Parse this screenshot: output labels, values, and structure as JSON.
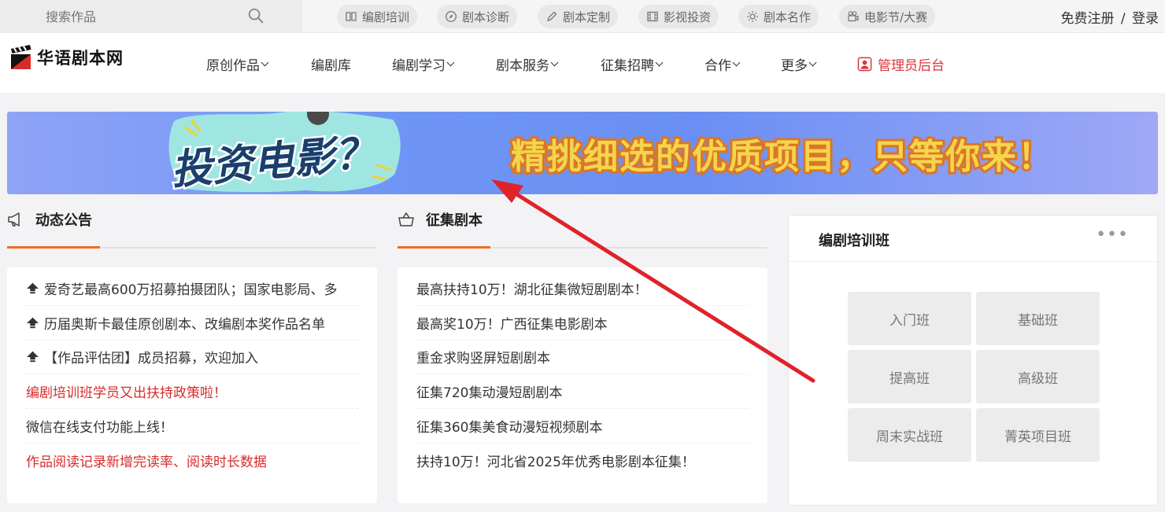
{
  "topbar": {
    "search_placeholder": "搜索作品",
    "pills": [
      {
        "label": "编剧培训",
        "icon": "book-icon"
      },
      {
        "label": "剧本诊断",
        "icon": "compass-icon"
      },
      {
        "label": "剧本定制",
        "icon": "pen-icon"
      },
      {
        "label": "影视投资",
        "icon": "film-icon"
      },
      {
        "label": "剧本名作",
        "icon": "sun-icon"
      },
      {
        "label": "电影节/大赛",
        "icon": "camera-icon"
      }
    ],
    "register": "免费注册",
    "separator": "/",
    "login": "登录"
  },
  "nav": {
    "logo_text": "华语剧本网",
    "items": [
      {
        "label": "原创作品",
        "dropdown": true
      },
      {
        "label": "编剧库",
        "dropdown": false
      },
      {
        "label": "编剧学习",
        "dropdown": true
      },
      {
        "label": "剧本服务",
        "dropdown": true
      },
      {
        "label": "征集招聘",
        "dropdown": true
      },
      {
        "label": "合作",
        "dropdown": true
      },
      {
        "label": "更多",
        "dropdown": true
      }
    ],
    "admin": "管理员后台"
  },
  "banner": {
    "headline": "投资电影？",
    "slogan": "精挑细选的优质项目，只等你来！"
  },
  "announcements": {
    "title": "动态公告",
    "items": [
      {
        "text": "爱奇艺最高600万招募拍摄团队；国家电影局、多",
        "pinned": true,
        "red": false
      },
      {
        "text": "历届奥斯卡最佳原创剧本、改编剧本奖作品名单",
        "pinned": true,
        "red": false
      },
      {
        "text": "【作品评估团】成员招募，欢迎加入",
        "pinned": true,
        "red": false
      },
      {
        "text": "编剧培训班学员又出扶持政策啦！",
        "pinned": false,
        "red": true
      },
      {
        "text": "微信在线支付功能上线！",
        "pinned": false,
        "red": false
      },
      {
        "text": "作品阅读记录新增完读率、阅读时长数据",
        "pinned": false,
        "red": true
      }
    ]
  },
  "collection": {
    "title": "征集剧本",
    "items": [
      "最高扶持10万！湖北征集微短剧剧本！",
      "最高奖10万！广西征集电影剧本",
      "重金求购竖屏短剧剧本",
      "征集720集动漫短剧剧本",
      "征集360集美食动漫短视频剧本",
      "扶持10万！河北省2025年优秀电影剧本征集！"
    ]
  },
  "training": {
    "title": "编剧培训班",
    "more": "•••",
    "classes": [
      "入门班",
      "基础班",
      "提高班",
      "高级班",
      "周末实战班",
      "菁英项目班"
    ]
  },
  "colors": {
    "accent_orange": "#ef6c1e",
    "alert_red": "#d92b2b",
    "annotation_arrow": "#e0222a",
    "banner_blue": "#6e95f5"
  }
}
